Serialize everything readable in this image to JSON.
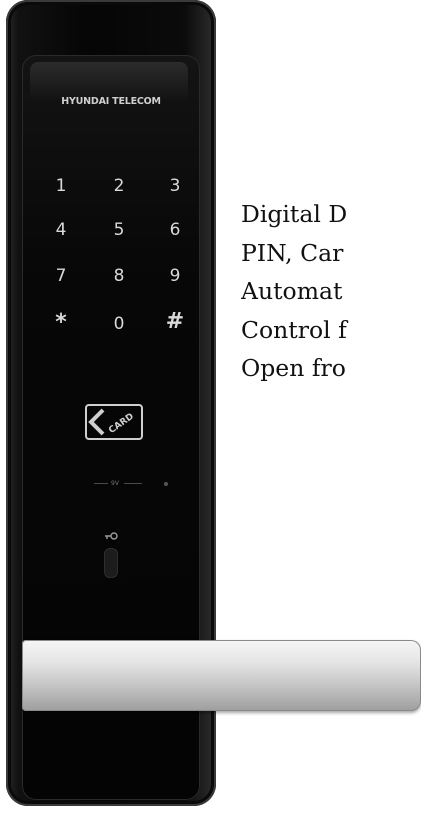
{
  "product": {
    "brand": "HYUNDAI TELECOM",
    "keypad": [
      "1",
      "2",
      "3",
      "4",
      "5",
      "6",
      "7",
      "8",
      "9",
      "*",
      "0",
      "#"
    ],
    "card_label": "CARD",
    "indicator_label": "9V"
  },
  "features": [
    "Digital D",
    "PIN, Car",
    "Automat",
    "Control f",
    "Open fro"
  ],
  "colors": {
    "lock_body": "#050505",
    "keypad_text": "#d9d9d9",
    "handle": "#d6d6d6",
    "text": "#111111"
  }
}
